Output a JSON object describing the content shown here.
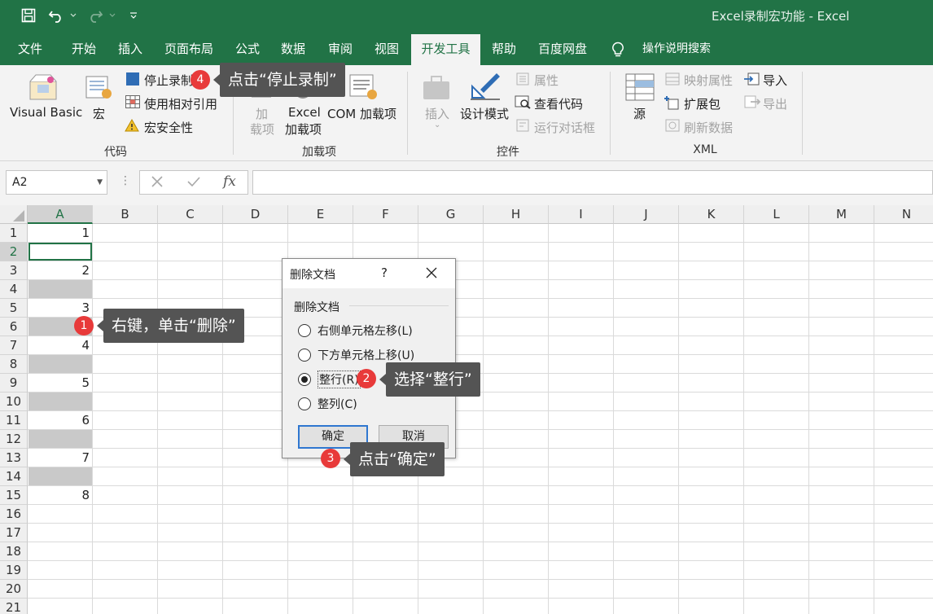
{
  "window": {
    "title": "Excel录制宏功能  -  Excel"
  },
  "tabs": [
    "文件",
    "开始",
    "插入",
    "页面布局",
    "公式",
    "数据",
    "审阅",
    "视图",
    "开发工具",
    "帮助",
    "百度网盘"
  ],
  "active_tab": "开发工具",
  "tell_me": "操作说明搜索",
  "ribbon": {
    "code": {
      "label": "代码",
      "visual_basic": "Visual Basic",
      "macro": "宏",
      "stop_recording": "停止录制",
      "relative_ref": "使用相对引用",
      "macro_security": "宏安全性"
    },
    "addins": {
      "label": "加载项",
      "addins_line1": "加",
      "addins_line2": "载项",
      "excel_addins_line1": "Excel",
      "excel_addins_line2": "加载项",
      "com_addins": "COM 加载项"
    },
    "controls": {
      "label": "控件",
      "insert": "插入",
      "design_mode": "设计模式",
      "properties": "属性",
      "view_code": "查看代码",
      "run_dialog": "运行对话框"
    },
    "xml": {
      "label": "XML",
      "source": "源",
      "map_properties": "映射属性",
      "expansion_packs": "扩展包",
      "refresh_data": "刷新数据",
      "import": "导入",
      "export": "导出"
    }
  },
  "formula_bar": {
    "name_box": "A2",
    "fx": "fx",
    "value": ""
  },
  "grid": {
    "columns": [
      "A",
      "B",
      "C",
      "D",
      "E",
      "F",
      "G",
      "H",
      "I",
      "J",
      "K",
      "L",
      "M",
      "N"
    ],
    "rows": [
      "1",
      "2",
      "3",
      "4",
      "5",
      "6",
      "7",
      "8",
      "9",
      "10",
      "11",
      "12",
      "13",
      "14",
      "15",
      "16",
      "17",
      "18",
      "19",
      "20",
      "21"
    ],
    "col_a_values": [
      "1",
      "",
      "2",
      "",
      "3",
      "",
      "4",
      "",
      "5",
      "",
      "6",
      "",
      "7",
      "",
      "8"
    ]
  },
  "dialog": {
    "title": "删除文档",
    "help": "?",
    "group": "删除文档",
    "options": [
      "右侧单元格左移(L)",
      "下方单元格上移(U)",
      "整行(R)",
      "整列(C)"
    ],
    "selected": "整行(R)",
    "ok": "确定",
    "cancel": "取消"
  },
  "callouts": [
    {
      "num": "1",
      "text": "右键，单击“删除”"
    },
    {
      "num": "2",
      "text": "选择“整行”"
    },
    {
      "num": "3",
      "text": "点击“确定”"
    },
    {
      "num": "4",
      "text": "点击“停止录制”"
    }
  ],
  "colors": {
    "excel_green": "#217346",
    "badge_red": "#e83a3a",
    "callout_bg": "#545454",
    "blank_cell": "#c9c9c9"
  }
}
